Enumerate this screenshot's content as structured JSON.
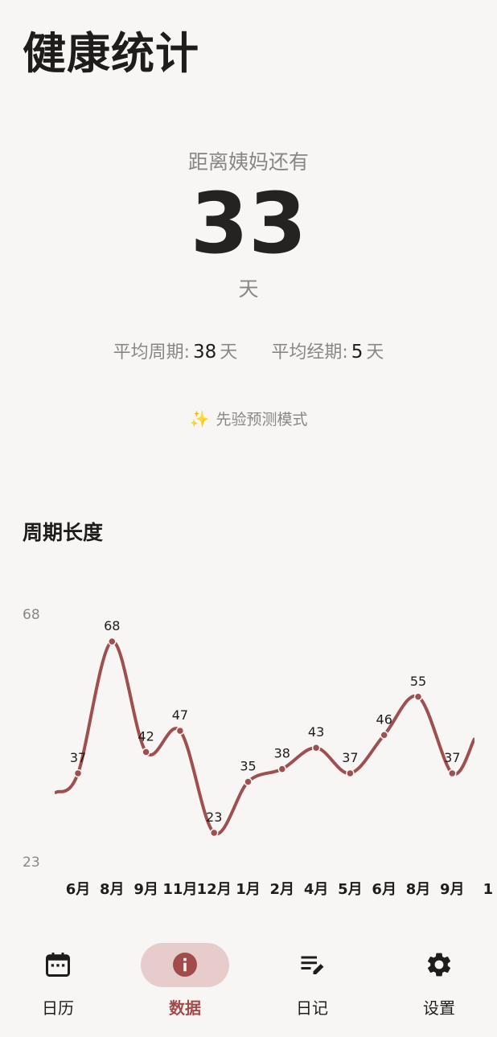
{
  "header": {
    "title": "健康统计"
  },
  "countdown": {
    "label": "距离姨妈还有",
    "days": "33",
    "unit": "天"
  },
  "stats": {
    "avg_cycle_label": "平均周期:",
    "avg_cycle_value": "38",
    "avg_cycle_unit": "天",
    "avg_period_label": "平均经期:",
    "avg_period_value": "5",
    "avg_period_unit": "天"
  },
  "mode": {
    "icon": "sparkles-icon",
    "label": "先验预测模式"
  },
  "cycle_section": {
    "title": "周期长度"
  },
  "chart_data": {
    "type": "line",
    "categories": [
      "6月",
      "8月",
      "9月",
      "11月",
      "12月",
      "1月",
      "2月",
      "4月",
      "5月",
      "6月",
      "8月",
      "9月",
      "1"
    ],
    "values": [
      37,
      68,
      42,
      47,
      23,
      35,
      38,
      43,
      37,
      46,
      55,
      37
    ],
    "ylim": [
      23,
      68
    ],
    "y_tick_labels": [
      "68",
      "23"
    ],
    "line_color": "#9e4f4f",
    "grid": false
  },
  "nav": {
    "items": [
      {
        "label": "日历",
        "icon": "calendar-icon"
      },
      {
        "label": "数据",
        "icon": "info-icon"
      },
      {
        "label": "日记",
        "icon": "notes-edit-icon"
      },
      {
        "label": "设置",
        "icon": "gear-icon"
      }
    ],
    "active_index": 1,
    "accent_color": "#a24b4b",
    "active_bg": "#e7cccc"
  }
}
